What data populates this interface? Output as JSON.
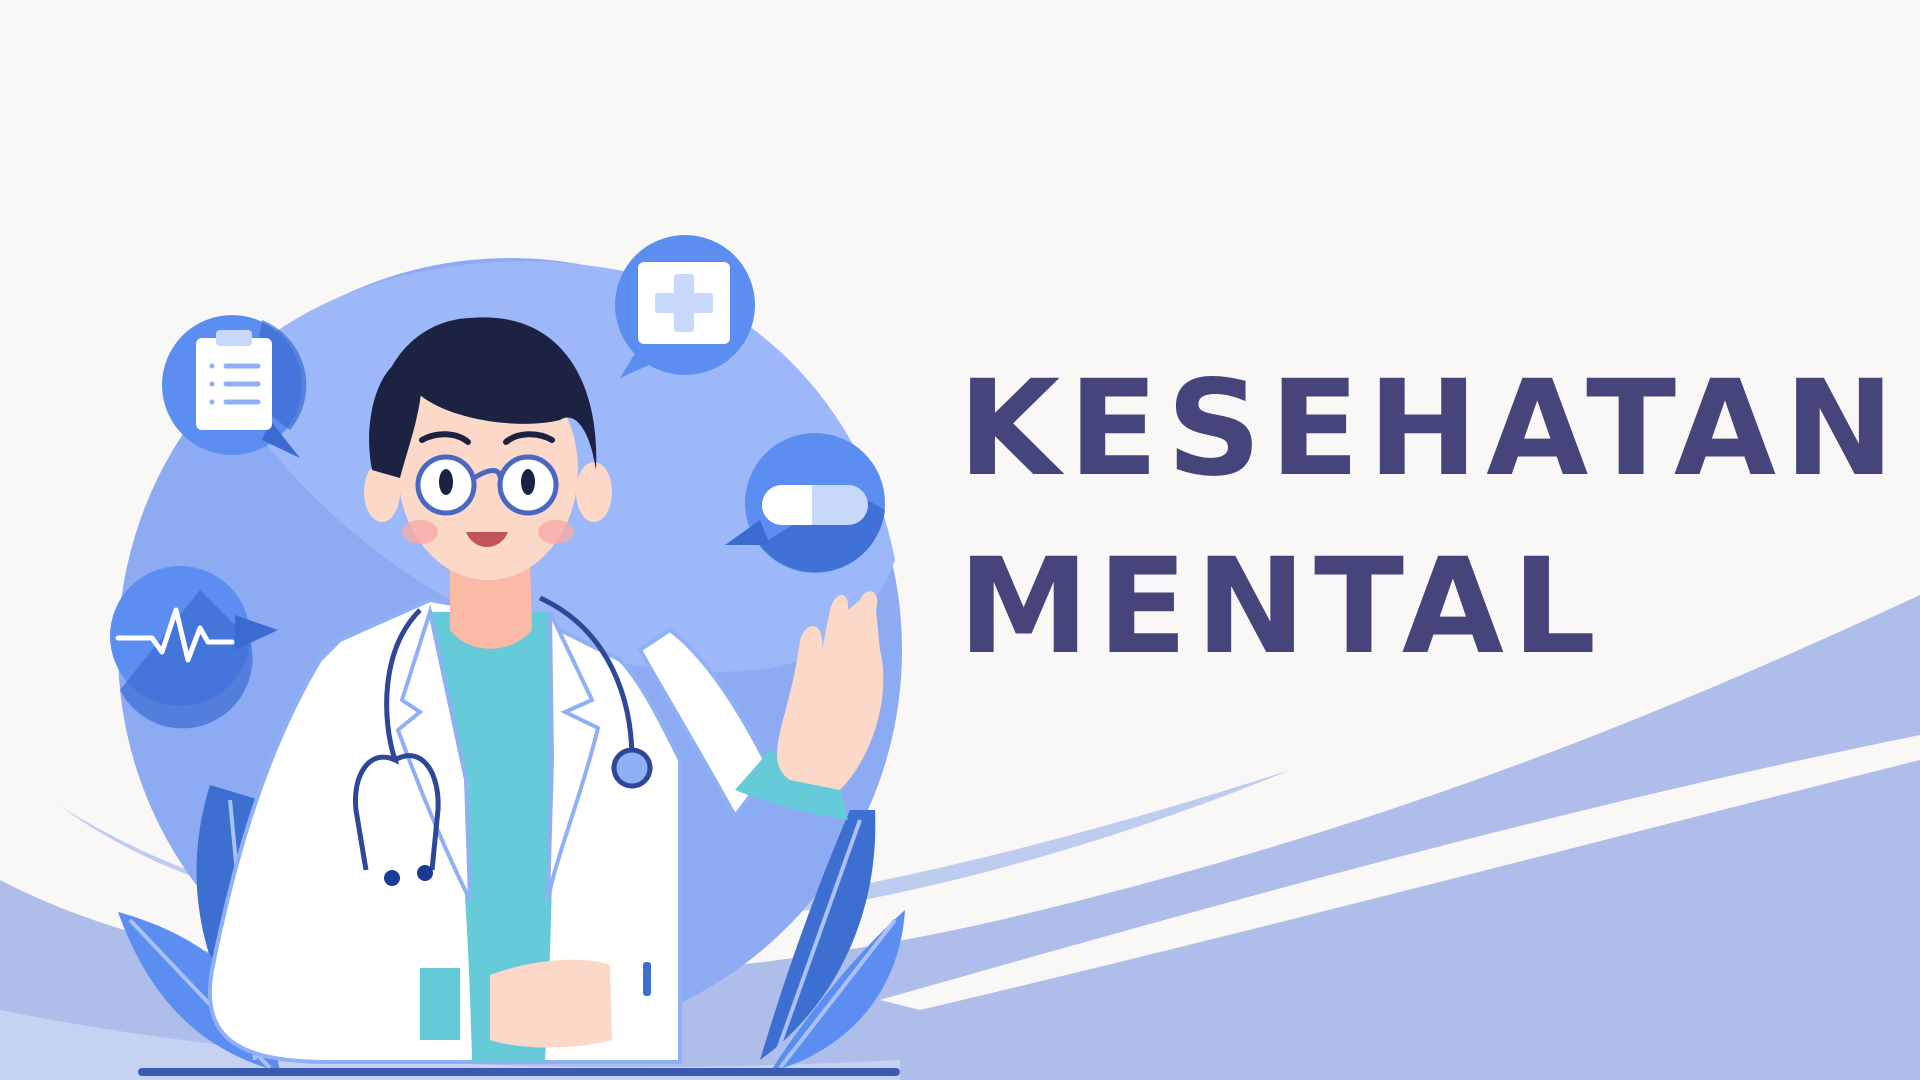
{
  "title": {
    "line1": "KESEHATAN",
    "line2": "MENTAL"
  },
  "colors": {
    "background": "#faf8f6",
    "title_text": "#45447b",
    "wave": "#aebde9",
    "circle": "#8cabf3",
    "bubble": "#5b8ef0",
    "bubble_dark": "#3a6bd0",
    "coat": "#ffffff",
    "scrubs": "#66cbd8",
    "hair": "#1c2242",
    "skin": "#fcd8c9"
  },
  "icons": [
    "clipboard-icon",
    "first-aid-cross-icon",
    "pill-icon",
    "heartbeat-icon",
    "stethoscope-icon"
  ]
}
